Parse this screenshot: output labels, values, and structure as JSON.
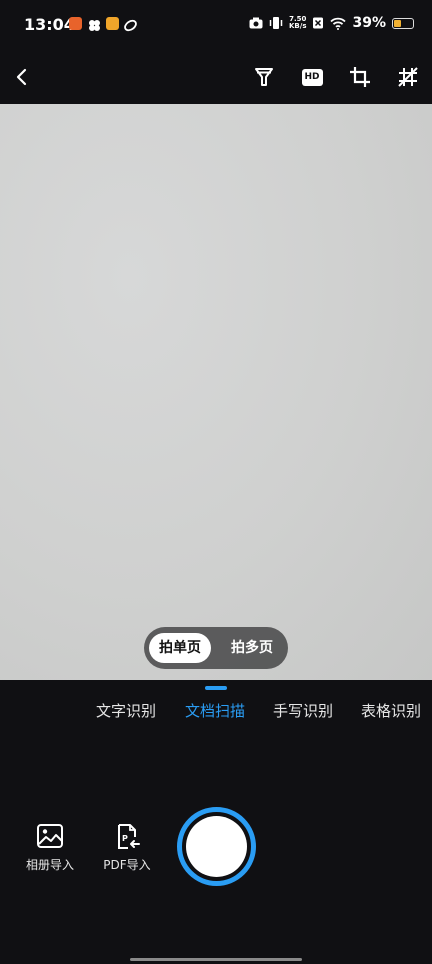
{
  "status_bar": {
    "time": "13:04",
    "net_speed_value": "7.50",
    "net_speed_unit": "KB/s",
    "battery_percent": "39%",
    "battery_level": 0.39,
    "colors": {
      "battery": "#f2b233"
    }
  },
  "toolbar": {
    "back_icon": "chevron-left-icon",
    "filter_icon": "filter-icon",
    "hd_label": "HD",
    "crop_icon": "crop-icon",
    "grid_off_icon": "grid-off-icon"
  },
  "capture_mode": {
    "single_label": "拍单页",
    "multi_label": "拍多页",
    "selected": "拍单页"
  },
  "mode_tabs": {
    "items": [
      "文字识别",
      "文档扫描",
      "手写识别",
      "表格识别"
    ],
    "active": "文档扫描",
    "accent": "#2a9df4"
  },
  "bottom": {
    "album_import_label": "相册导入",
    "pdf_import_label": "PDF导入"
  }
}
